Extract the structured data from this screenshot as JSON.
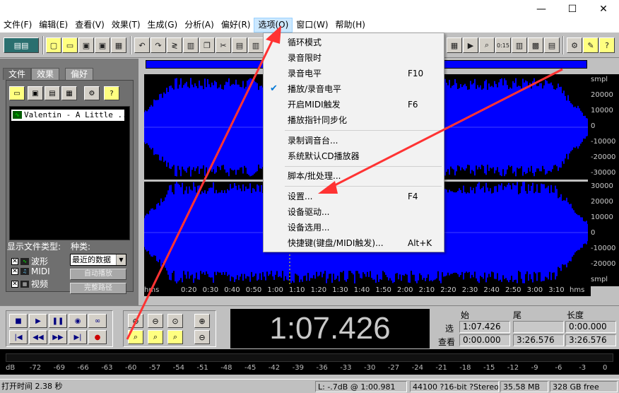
{
  "titlebar": {
    "minimize": "—",
    "maximize": "☐",
    "close": "✕"
  },
  "menubar": {
    "items": [
      "文件(F)",
      "编辑(E)",
      "查看(V)",
      "效果(T)",
      "生成(G)",
      "分析(A)",
      "偏好(R)",
      "选项(O)",
      "窗口(W)",
      "帮助(H)"
    ]
  },
  "leftpanel": {
    "tabs": [
      "文件",
      "效果",
      "偏好"
    ],
    "file_entry": "Valentin - A Little ...",
    "show_types_label": "显示文件类型:",
    "kind_label": "种类:",
    "file_types": [
      "波形",
      "MIDI",
      "视频"
    ],
    "kind_select": "最近的数据",
    "autoplay": "自动播放",
    "fullpath": "完整路径"
  },
  "wave": {
    "ruler_right_top": [
      "smpl",
      "20000",
      "10000",
      "0",
      "-10000",
      "-20000",
      "-30000"
    ],
    "ruler_right_bottom": [
      "30000",
      "20000",
      "10000",
      "0",
      "-10000",
      "-20000",
      "smpl"
    ],
    "time_ticks": [
      "hms",
      "0:20",
      "0:30",
      "0:40",
      "0:50",
      "1:00",
      "1:10",
      "1:20",
      "1:30",
      "1:40",
      "1:50",
      "2:00",
      "2:10",
      "2:20",
      "2:30",
      "2:40",
      "2:50",
      "3:00",
      "3:10",
      "hms"
    ],
    "wave_color": "#0000ff",
    "background": "#000000"
  },
  "transport": {
    "time": "1:07.426",
    "sel_head": [
      "始",
      "尾",
      "长度"
    ],
    "sel_row_label": "选",
    "view_row_label": "查看",
    "sel_begin": "1:07.426",
    "sel_end": "",
    "sel_length": "0:00.000",
    "view_begin": "0:00.000",
    "view_end": "3:26.576",
    "view_length": "3:26.576"
  },
  "meter": {
    "ticks": [
      "dB",
      "-72",
      "-69",
      "-66",
      "-63",
      "-60",
      "-57",
      "-54",
      "-51",
      "-48",
      "-45",
      "-42",
      "-39",
      "-36",
      "-33",
      "-30",
      "-27",
      "-24",
      "-21",
      "-18",
      "-15",
      "-12",
      "-9",
      "-6",
      "-3",
      "0"
    ]
  },
  "statusbar": {
    "open_time": "打开时间 2.38 秒",
    "level": "L: -.7dB @ 1:00.981",
    "format": "44100 ?16-bit ?Stereo",
    "size": "35.58 MB",
    "free": "328 GB free"
  },
  "dropdown": {
    "items": [
      {
        "label": "循环模式",
        "key": "",
        "checked": false
      },
      {
        "label": "录音限时",
        "key": "",
        "checked": false
      },
      {
        "label": "录音电平",
        "key": "F10",
        "checked": false
      },
      {
        "label": "播放/录音电平",
        "key": "",
        "checked": true
      },
      {
        "label": "开启MIDI触发",
        "key": "F6",
        "checked": false
      },
      {
        "label": "播放指针同步化",
        "key": "",
        "checked": false
      },
      {
        "label": "录制调音台...",
        "key": "",
        "checked": false
      },
      {
        "label": "系统默认CD播放器",
        "key": "",
        "checked": false
      },
      {
        "label": "脚本/批处理...",
        "key": "",
        "checked": false
      },
      {
        "label": "设置...",
        "key": "F4",
        "checked": false
      },
      {
        "label": "设备驱动...",
        "key": "",
        "checked": false
      },
      {
        "label": "设备选用...",
        "key": "",
        "checked": false
      },
      {
        "label": "快捷键(键盘/MIDI触发)...",
        "key": "Alt+K",
        "checked": false
      }
    ],
    "checkmark": "✔"
  },
  "annotation_color": "#ff3333"
}
